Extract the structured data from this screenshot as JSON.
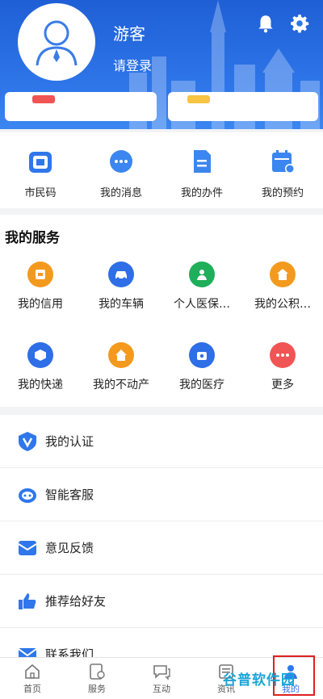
{
  "header": {
    "guest": "游客",
    "login": "请登录"
  },
  "quick": [
    {
      "label": "市民码",
      "icon": "citizen-code-icon"
    },
    {
      "label": "我的消息",
      "icon": "message-icon"
    },
    {
      "label": "我的办件",
      "icon": "document-icon"
    },
    {
      "label": "我的预约",
      "icon": "calendar-icon"
    }
  ],
  "services": {
    "title": "我的服务",
    "row1": [
      {
        "label": "我的信用",
        "icon": "credit-icon",
        "color": "#f39a1e"
      },
      {
        "label": "我的车辆",
        "icon": "car-icon",
        "color": "#2e6ee6"
      },
      {
        "label": "个人医保…",
        "icon": "medical-insurance-icon",
        "color": "#1fae5a"
      },
      {
        "label": "我的公积…",
        "icon": "housing-fund-icon",
        "color": "#f39a1e"
      }
    ],
    "row2": [
      {
        "label": "我的快递",
        "icon": "package-icon",
        "color": "#2e6ee6"
      },
      {
        "label": "我的不动产",
        "icon": "house-icon",
        "color": "#f39a1e"
      },
      {
        "label": "我的医疗",
        "icon": "medical-icon",
        "color": "#2e6ee6"
      },
      {
        "label": "更多",
        "icon": "more-icon",
        "color": "#f05454"
      }
    ]
  },
  "list": [
    {
      "label": "我的认证",
      "icon": "verify-icon"
    },
    {
      "label": "智能客服",
      "icon": "robot-icon"
    },
    {
      "label": "意见反馈",
      "icon": "feedback-icon"
    },
    {
      "label": "推荐给好友",
      "icon": "thumbs-up-icon"
    },
    {
      "label": "联系我们",
      "icon": "mail-icon"
    }
  ],
  "tabs": [
    {
      "label": "首页",
      "icon": "home-icon"
    },
    {
      "label": "服务",
      "icon": "service-icon"
    },
    {
      "label": "互动",
      "icon": "chat-icon"
    },
    {
      "label": "资讯",
      "icon": "news-icon"
    },
    {
      "label": "我的",
      "icon": "profile-icon"
    }
  ],
  "watermark": "谷普软件园",
  "colors": {
    "primary": "#2f77ea",
    "highlight": "#e02020"
  }
}
